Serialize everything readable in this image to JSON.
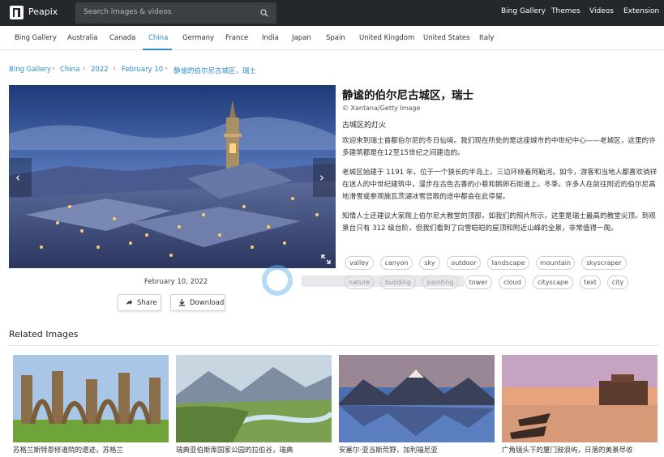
{
  "header": {
    "brand": "Peapix",
    "search_placeholder": "Search images & videos",
    "nav": [
      "Bing Gallery",
      "Themes",
      "Videos",
      "Extension"
    ]
  },
  "countries": [
    "Bing Gallery",
    "Australia",
    "Canada",
    "China",
    "Germany",
    "France",
    "India",
    "Japan",
    "Spain",
    "United Kingdom",
    "United States",
    "Italy"
  ],
  "active_country": "China",
  "breadcrumb": [
    "Bing Gallery",
    "China",
    "2022",
    "February 10",
    "静谧的伯尔尼古城区，瑞士"
  ],
  "image": {
    "date": "February 10, 2022",
    "share_label": "Share",
    "download_label": "Download"
  },
  "article": {
    "title": "静谧的伯尔尼古城区，瑞士",
    "credit": "© Xantana/Getty Image",
    "subtitle": "古城区的灯火",
    "p1": "欢迎来到瑞士首都伯尔尼的冬日仙境。我们现在所处的是这座城市的中世纪中心——老城区，这里的许多建筑都是在12至15世纪之间建造的。",
    "p2": "老城区始建于 1191 年，位于一个狭长的半岛上，三边环绕着阿勒河。如今，游客和当地人都喜欢徜徉在迷人的中世纪建筑中，漫步在古色古香的小巷和鹅卵石街道上。冬季，许多人在前往附近的伯尔尼高地滑雪或参观施瓦茨湖冰雪宫殿的途中都会在此停留。",
    "p3": "知情人士还建议大家爬上伯尔尼大教堂的顶部，如我们的照片所示，这里是瑞士最高的教堂尖顶。到观景台只有 312 级台阶，但我们看到了白雪皑皑的屋顶和附近山峰的全景，非常值得一爬。"
  },
  "tags": [
    "valley",
    "canyon",
    "sky",
    "outdoor",
    "landscape",
    "mountain",
    "skyscraper",
    "nature",
    "building",
    "painting",
    "tower",
    "cloud",
    "cityscape",
    "text",
    "city"
  ],
  "related": {
    "title": "Related Images",
    "items": [
      "苏格兰斯特恩修道院的遗迹，苏格兰",
      "瑞典亚伯斯库国家公园的拉伯谷，瑞典",
      "安塞尔·亚当斯荒野，加利福尼亚",
      "广角镜头下的厦门鼓浪屿，日落的美景尽收"
    ]
  },
  "colors": {
    "topbar": "#24272b",
    "accent": "#2a8ec9"
  }
}
